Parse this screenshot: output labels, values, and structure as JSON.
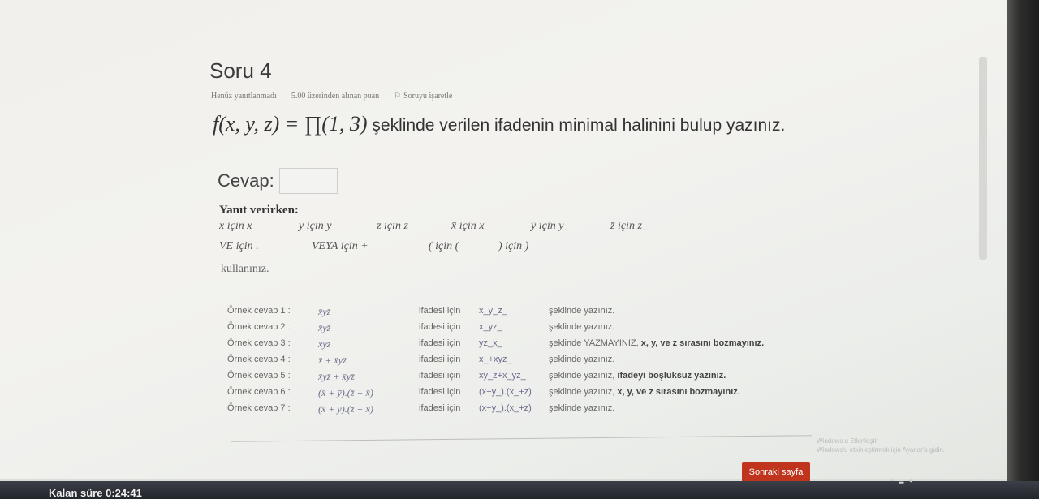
{
  "question": {
    "title": "Soru 4",
    "status": "Henüz yanıtlanmadı",
    "points": "5.00 üzerinden alınan puan",
    "flag_label": "Soruyu işaretle",
    "formula": "f(x, y, z) = ∏(1, 3)",
    "text_after_formula": " şeklinde verilen ifadenin minimal halinini bulup yazınız."
  },
  "answer": {
    "label": "Cevap:",
    "value": ""
  },
  "hints": {
    "title": "Yanıt verirken:",
    "row1": [
      "x için x",
      "y için y",
      "z için z",
      "x̄ için x_",
      "ȳ için y_",
      "z̄ için z_"
    ],
    "row2": [
      "VE için .",
      "VEYA için +",
      "( için (",
      ") için )"
    ],
    "footer": "kullanınız."
  },
  "examples": [
    {
      "label": "Örnek cevap 1 :",
      "expr": "x̄yz̄",
      "ifadesi": "ifadesi için",
      "answer": "x_y_z_",
      "note": "şeklinde yazınız.",
      "bold": ""
    },
    {
      "label": "Örnek cevap 2 :",
      "expr": "x̄yz̄",
      "ifadesi": "ifadesi için",
      "answer": "x_yz_",
      "note": "şeklinde yazınız.",
      "bold": ""
    },
    {
      "label": "Örnek cevap 3 :",
      "expr": "x̄yz̄",
      "ifadesi": "ifadesi için",
      "answer": "yz_x_",
      "note": "şeklinde YAZMAYINIZ,",
      "bold": "x, y, ve z sırasını bozmayınız."
    },
    {
      "label": "Örnek cevap 4 :",
      "expr": "x̄ + x̄yz̄",
      "ifadesi": "ifadesi için",
      "answer": "x_+xyz_",
      "note": "şeklinde yazınız.",
      "bold": ""
    },
    {
      "label": "Örnek cevap 5 :",
      "expr": "x̄yz̄ + x̄yz̄",
      "ifadesi": "ifadesi için",
      "answer": "xy_z+x_yz_",
      "note": "şeklinde yazınız,",
      "bold": "ifadeyi boşluksuz yazınız."
    },
    {
      "label": "Örnek cevap 6 :",
      "expr": "(x̄ + ȳ).(z̄ + x̄)",
      "ifadesi": "ifadesi için",
      "answer": "(x+y_).(x_+z)",
      "note": "şeklinde yazınız,",
      "bold": "x, y, ve z sırasını bozmayınız."
    },
    {
      "label": "Örnek cevap 7 :",
      "expr": "(x̄ + ȳ).(z̄ + x̄)",
      "ifadesi": "ifadesi için",
      "answer": "(x+y_).(x_+z)",
      "note": "şeklinde yazınız.",
      "bold": ""
    }
  ],
  "navigation": {
    "next_label": "Sonraki sayfa"
  },
  "watermark": {
    "line1": "Windows u Etkinleştir",
    "line2": "Windows'u etkinleştirmek için Ayarlar'a gidin."
  },
  "timer": "Kalan süre 0:24:41",
  "colors": {
    "next_button": "#c0341e"
  }
}
